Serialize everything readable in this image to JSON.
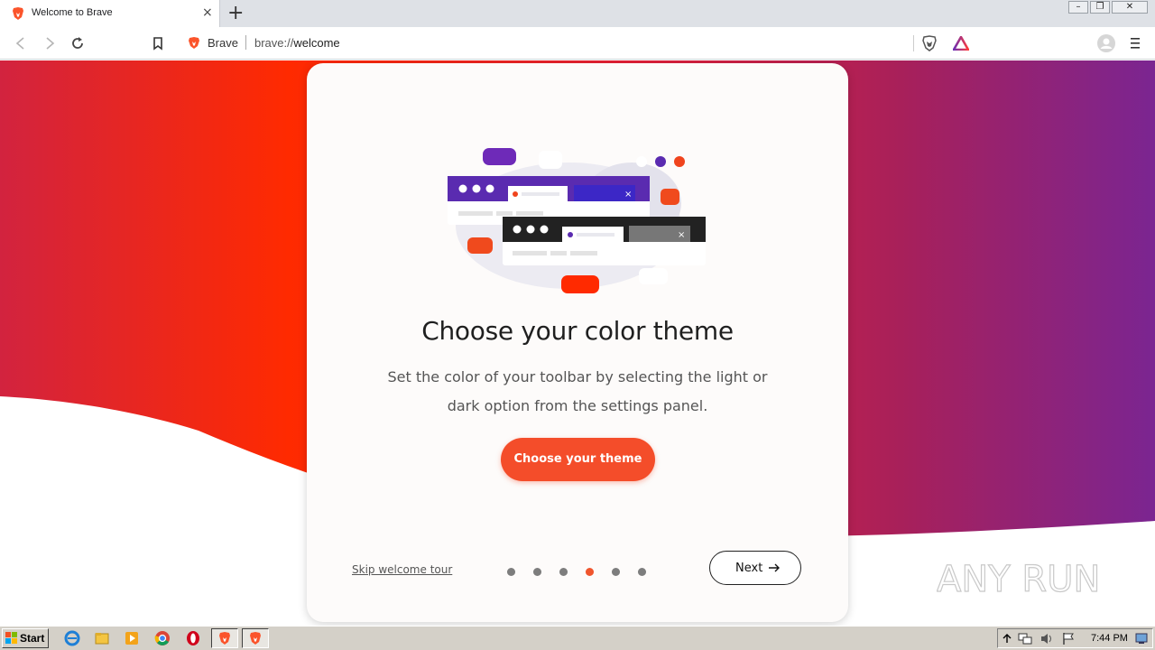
{
  "browser": {
    "tab_title": "Welcome to Brave",
    "tab_close": "×",
    "new_tab": "+",
    "window_controls": {
      "minimize": "–",
      "restore": "❐",
      "close": "✕"
    }
  },
  "toolbar": {
    "site_name": "Brave",
    "url_scheme": "brave://",
    "url_host": "welcome"
  },
  "welcome": {
    "title": "Choose your color theme",
    "description": "Set the color of your toolbar by selecting the light or dark option from the settings panel.",
    "primary_button": "Choose your theme",
    "skip_link": "Skip welcome tour",
    "next_button": "Next",
    "steps_total": 6,
    "active_step": 4
  },
  "watermark": "ANY RUN",
  "taskbar": {
    "start_label": "Start",
    "clock": "7:44 PM"
  },
  "colors": {
    "accent": "#f44d2a",
    "gradient_left": "#d2233f",
    "gradient_mid": "#ff2a00",
    "gradient_right": "#7b2591"
  }
}
